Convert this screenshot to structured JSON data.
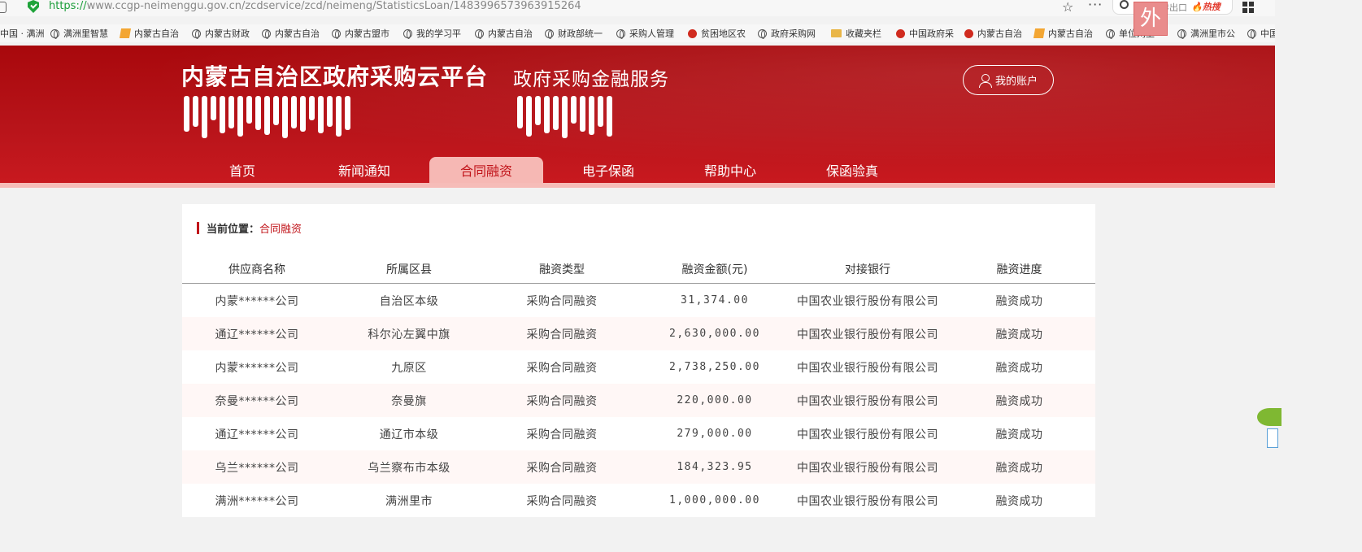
{
  "browser": {
    "url_proto": "https://",
    "url_rest": "www.ccgp-neimenggu.gov.cn/zcdservice/zcd/neimeng/StatisticsLoan/1483996573963915264",
    "search_hint": "日本排出口",
    "search_hot": "🔥热搜",
    "badge_text": "外",
    "bookmarks": [
      {
        "label": "中国 · 满洲",
        "icon": "none"
      },
      {
        "label": "满洲里智慧",
        "icon": "globe"
      },
      {
        "label": "内蒙古自治",
        "icon": "pin"
      },
      {
        "label": "内蒙古财政",
        "icon": "globe"
      },
      {
        "label": "内蒙古自治",
        "icon": "globe"
      },
      {
        "label": "内蒙古盟市",
        "icon": "globe"
      },
      {
        "label": "我的学习平",
        "icon": "globe"
      },
      {
        "label": "内蒙古自治",
        "icon": "globe"
      },
      {
        "label": "财政部统一",
        "icon": "globe"
      },
      {
        "label": "采购人管理",
        "icon": "globe"
      },
      {
        "label": "贫困地区农",
        "icon": "emblem"
      },
      {
        "label": "政府采购网",
        "icon": "globe"
      },
      {
        "label": "收藏夹栏",
        "icon": "folder"
      },
      {
        "label": "中国政府采",
        "icon": "emblem"
      },
      {
        "label": "内蒙古自治",
        "icon": "emblem"
      },
      {
        "label": "内蒙古自治",
        "icon": "pin"
      },
      {
        "label": "单位网上",
        "icon": "globe"
      },
      {
        "label": "满洲里市公",
        "icon": "globe"
      },
      {
        "label": "中国",
        "icon": "globe"
      }
    ]
  },
  "header": {
    "title": "内蒙古自治区政府采购云平台",
    "subtitle": "政府采购金融服务",
    "account_label": "我的账户"
  },
  "nav": [
    "首页",
    "新闻通知",
    "合同融资",
    "电子保函",
    "帮助中心",
    "保函验真"
  ],
  "breadcrumb": {
    "label": "当前位置：",
    "current": "合同融资"
  },
  "table": {
    "headers": [
      "供应商名称",
      "所属区县",
      "融资类型",
      "融资金额(元)",
      "对接银行",
      "融资进度"
    ],
    "rows": [
      [
        "内蒙******公司",
        "自治区本级",
        "采购合同融资",
        "31,374.00",
        "中国农业银行股份有限公司",
        "融资成功"
      ],
      [
        "通辽******公司",
        "科尔沁左翼中旗",
        "采购合同融资",
        "2,630,000.00",
        "中国农业银行股份有限公司",
        "融资成功"
      ],
      [
        "内蒙******公司",
        "九原区",
        "采购合同融资",
        "2,738,250.00",
        "中国农业银行股份有限公司",
        "融资成功"
      ],
      [
        "奈曼******公司",
        "奈曼旗",
        "采购合同融资",
        "220,000.00",
        "中国农业银行股份有限公司",
        "融资成功"
      ],
      [
        "通辽******公司",
        "通辽市本级",
        "采购合同融资",
        "279,000.00",
        "中国农业银行股份有限公司",
        "融资成功"
      ],
      [
        "乌兰******公司",
        "乌兰察布市本级",
        "采购合同融资",
        "184,323.95",
        "中国农业银行股份有限公司",
        "融资成功"
      ],
      [
        "满洲******公司",
        "满洲里市",
        "采购合同融资",
        "1,000,000.00",
        "中国农业银行股份有限公司",
        "融资成功"
      ]
    ]
  }
}
